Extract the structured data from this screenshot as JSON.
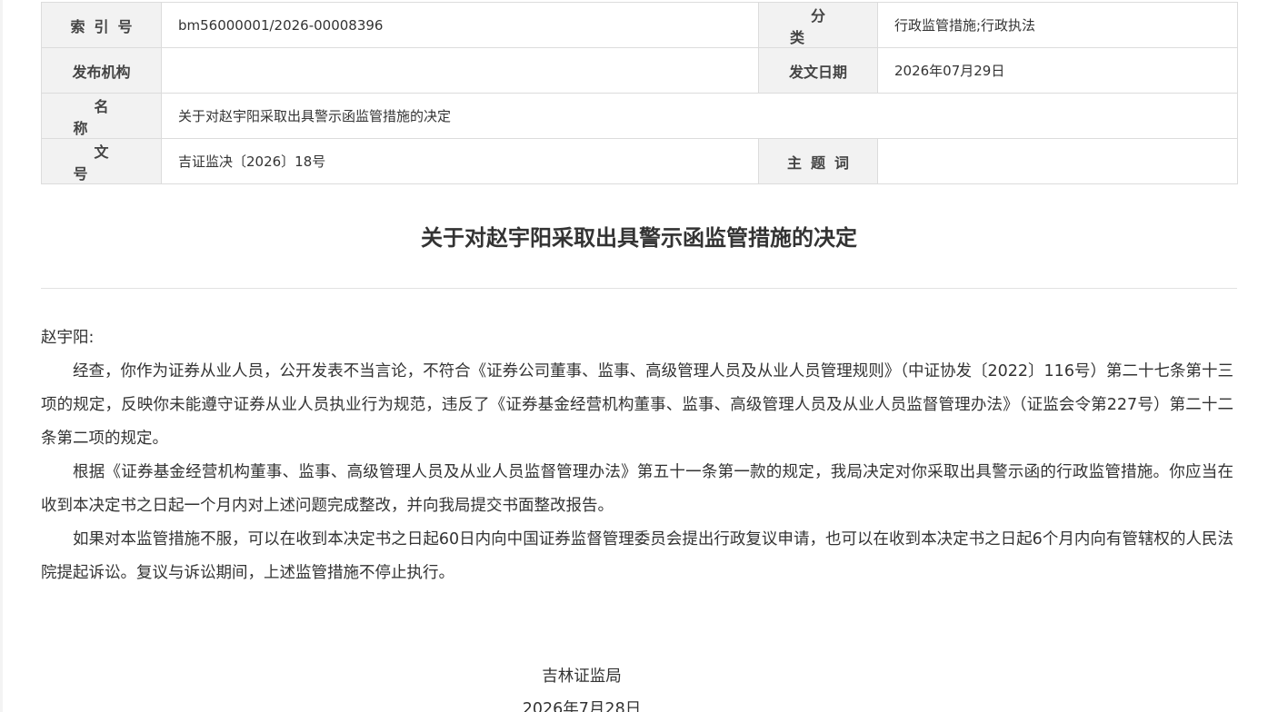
{
  "meta": {
    "index_label": "索引号",
    "index_value": "bm56000001/2026-00008396",
    "category_label": "分类",
    "category_value": "行政监管措施;行政执法",
    "issuer_label": "发布机构",
    "issuer_value": "",
    "date_label": "发文日期",
    "date_value": "2026年07月29日",
    "name_label": "名称",
    "name_value": "关于对赵宇阳采取出具警示函监管措施的决定",
    "docno_label": "文号",
    "docno_value": "吉证监决〔2026〕18号",
    "keywords_label": "主题词",
    "keywords_value": ""
  },
  "document": {
    "title": "关于对赵宇阳采取出具警示函监管措施的决定",
    "salutation": "赵宇阳:",
    "paragraphs": [
      "经查，你作为证券从业人员，公开发表不当言论，不符合《证券公司董事、监事、高级管理人员及从业人员管理规则》（中证协发〔2022〕116号）第二十七条第十三项的规定，反映你未能遵守证券从业人员执业行为规范，违反了《证券基金经营机构董事、监事、高级管理人员及从业人员监督管理办法》（证监会令第227号）第二十二条第二项的规定。",
      "根据《证券基金经营机构董事、监事、高级管理人员及从业人员监督管理办法》第五十一条第一款的规定，我局决定对你采取出具警示函的行政监管措施。你应当在收到本决定书之日起一个月内对上述问题完成整改，并向我局提交书面整改报告。",
      "如果对本监管措施不服，可以在收到本决定书之日起60日内向中国证券监督管理委员会提出行政复议申请，也可以在收到本决定书之日起6个月内向有管辖权的人民法院提起诉讼。复议与诉讼期间，上述监管措施不停止执行。"
    ],
    "issuer": "吉林证监局",
    "date": "2026年7月28日"
  }
}
